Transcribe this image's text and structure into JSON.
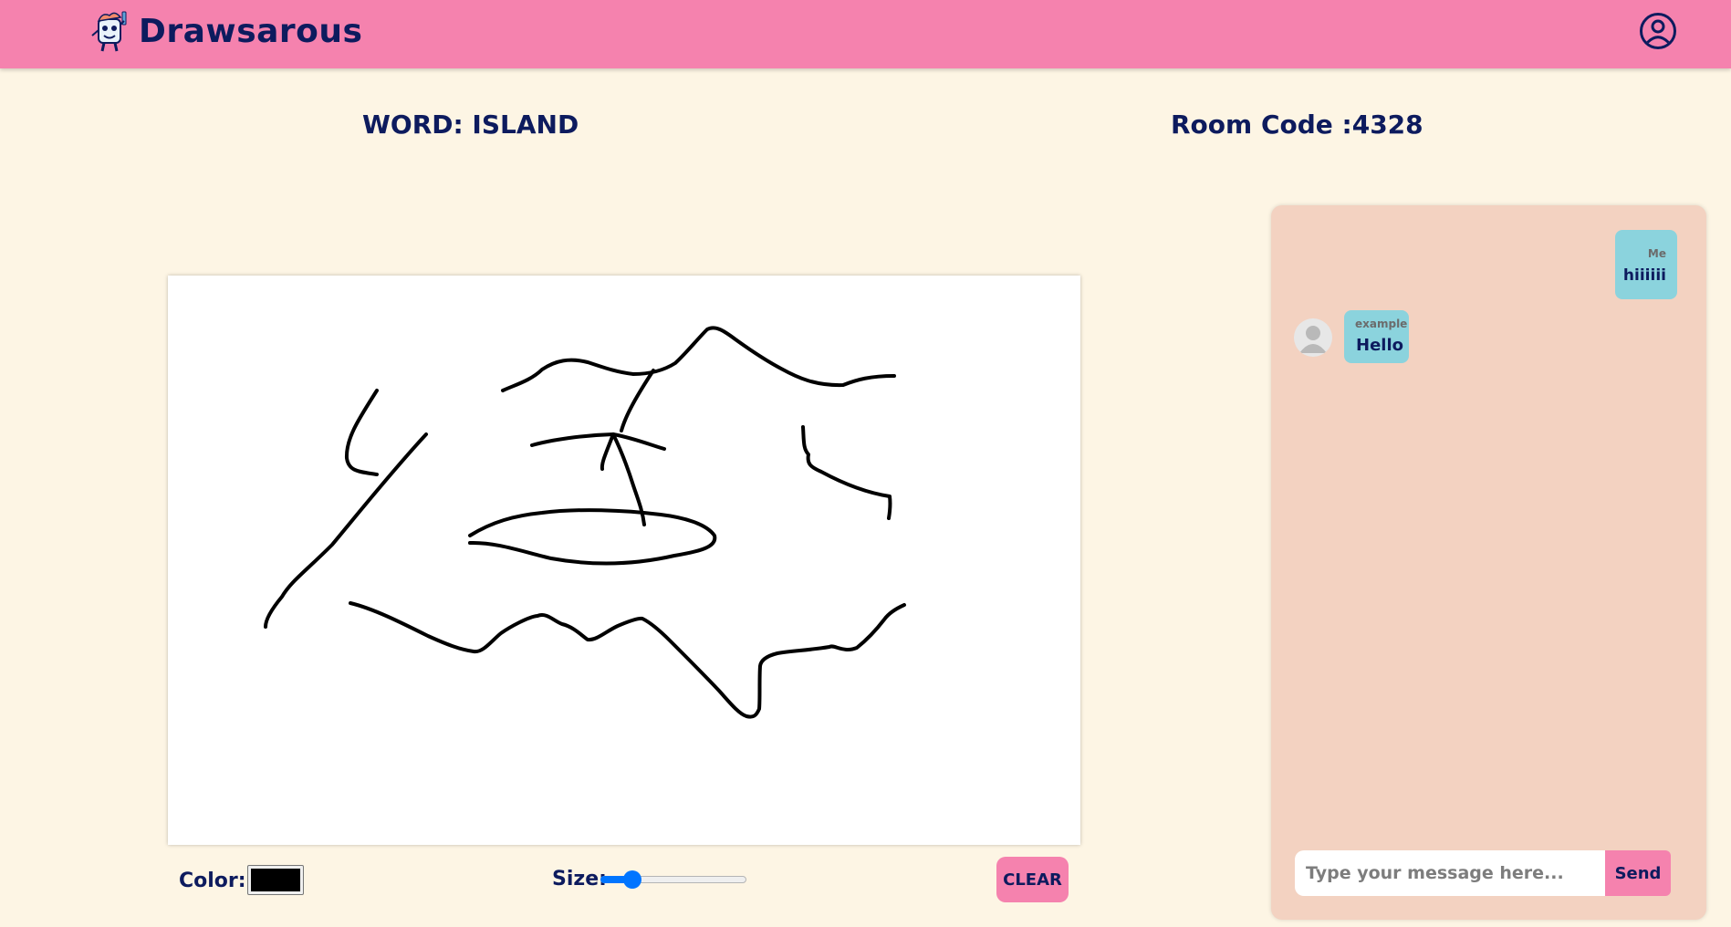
{
  "header": {
    "brand": "Drawsarous",
    "logo_icon": "cartoon-character-logo",
    "profile_icon": "user-circle-icon",
    "background": "#f582ae"
  },
  "game": {
    "word": "WORD: ISLAND",
    "room_code": "Room Code :4328"
  },
  "canvas": {
    "stroke_color": "#000000",
    "background": "#ffffff"
  },
  "toolbar": {
    "color_label": "Color:",
    "color_value": "#000000",
    "size_label": "Size:",
    "size_value": 0.18,
    "clear_label": "CLEAR"
  },
  "chat": {
    "messages": [
      {
        "sender": "Me",
        "text": "hiiiiii"
      },
      {
        "sender": "example",
        "text": "Hello"
      }
    ],
    "input_placeholder": "Type your message here...",
    "send_label": "Send",
    "panel_color": "#f3d2c1",
    "bubble_color": "#8bd3dd"
  }
}
